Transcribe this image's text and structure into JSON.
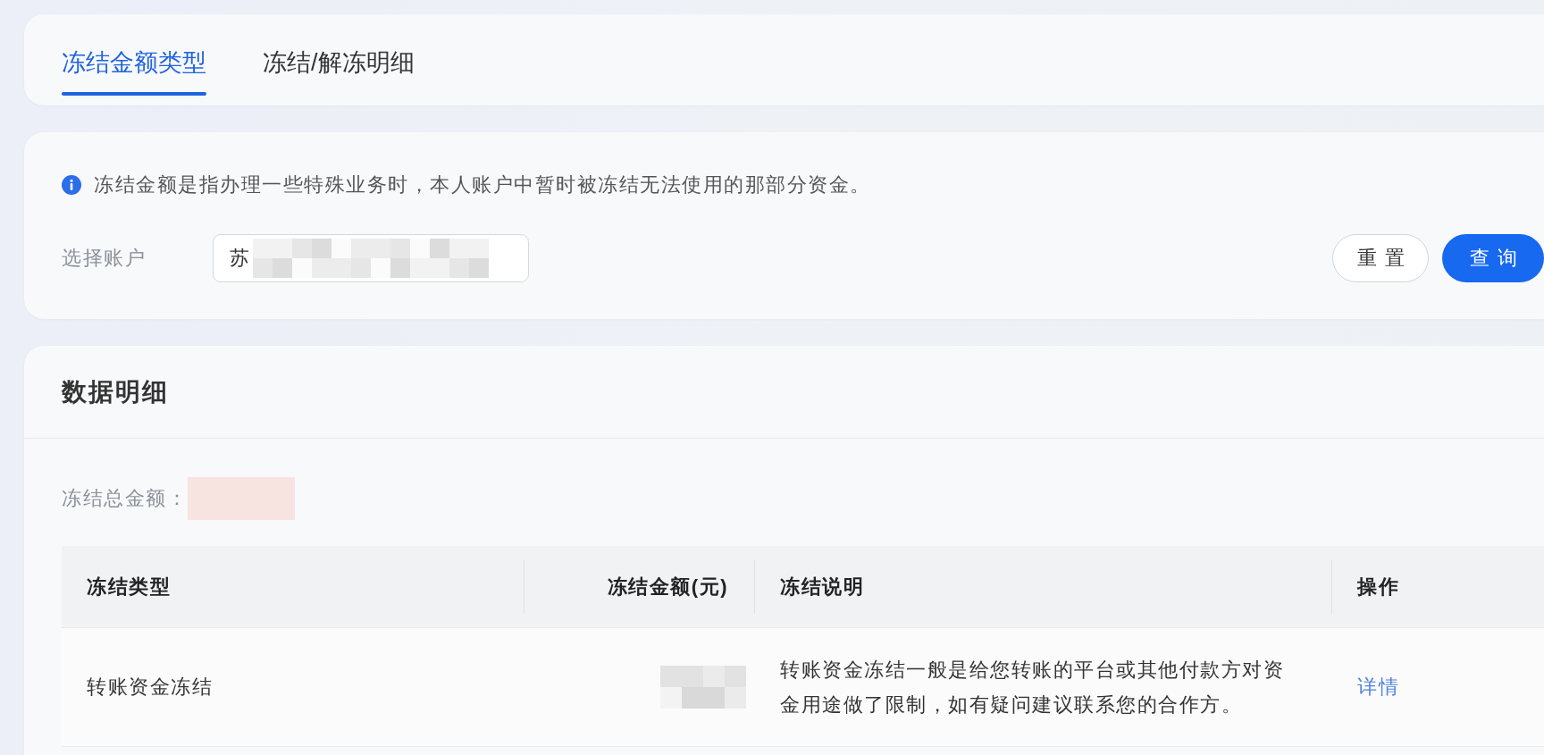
{
  "tabs": [
    {
      "label": "冻结金额类型",
      "selected": true
    },
    {
      "label": "冻结/解冻明细",
      "selected": false
    }
  ],
  "notice": {
    "text": "冻结金额是指办理一些特殊业务时，本人账户中暂时被冻结无法使用的那部分资金。"
  },
  "filter": {
    "label": "选择账户",
    "value": "苏",
    "redacted": true,
    "buttons": [
      {
        "label": "重置",
        "kind": "secondary"
      },
      {
        "label": "查询",
        "kind": "primary"
      }
    ]
  },
  "details": {
    "title": "数据明细",
    "total": {
      "label": "冻结总金额：",
      "redacted": true
    },
    "table": {
      "columns": [
        {
          "label": "冻结类型",
          "kind": "text"
        },
        {
          "label": "冻结金额(元)",
          "kind": "amount"
        },
        {
          "label": "冻结说明",
          "kind": "text"
        },
        {
          "label": "操作",
          "kind": "action"
        }
      ],
      "rows": [
        {
          "type": "转账资金冻结",
          "amount": {
            "redacted": true
          },
          "description": "转账资金冻结一般是给您转账的平台或其他付款方对资金用途做了限制，如有疑问建议联系您的合作方。",
          "action": "详情"
        }
      ]
    }
  }
}
